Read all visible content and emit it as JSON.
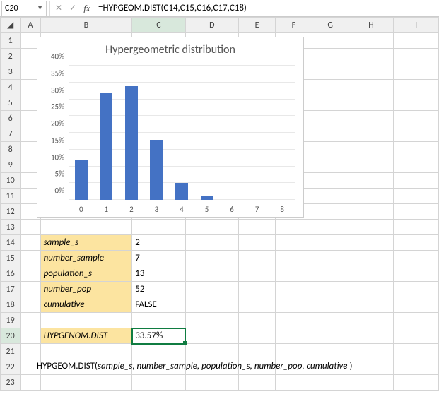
{
  "formula_bar": {
    "cell_ref": "C20",
    "formula": "=HYPGEOM.DIST(C14,C15,C16,C17,C18)",
    "cancel": "✕",
    "enter": "✓",
    "fx": "fx"
  },
  "columns": [
    "A",
    "B",
    "C",
    "D",
    "E",
    "F",
    "G",
    "H",
    "I"
  ],
  "rows": [
    "1",
    "2",
    "3",
    "4",
    "5",
    "6",
    "7",
    "8",
    "9",
    "10",
    "11",
    "12",
    "13",
    "14",
    "15",
    "16",
    "17",
    "18",
    "19",
    "20",
    "21",
    "22",
    "23"
  ],
  "params": {
    "r14": {
      "label": "sample_s",
      "value": "2"
    },
    "r15": {
      "label": "number_sample",
      "value": "7"
    },
    "r16": {
      "label": "population_s",
      "value": "13"
    },
    "r17": {
      "label": "number_pop",
      "value": "52"
    },
    "r18": {
      "label": "cumulative",
      "value": "FALSE"
    }
  },
  "result": {
    "label": "HYPGENOM.DIST",
    "value": "33.57%"
  },
  "syntax": {
    "fn": "HYPGEOM.DIST(",
    "args": "sample_s, number_sample, population_s, number_pop, cumulative",
    "end": " )"
  },
  "chart_data": {
    "type": "bar",
    "title": "Hypergeometric distribution",
    "categories": [
      "0",
      "1",
      "2",
      "3",
      "4",
      "5",
      "6",
      "7",
      "8"
    ],
    "values": [
      12,
      32,
      34,
      18,
      5,
      1,
      0,
      0,
      0
    ],
    "ylim": [
      0,
      40
    ],
    "yticks": [
      "0%",
      "5%",
      "10%",
      "15%",
      "20%",
      "25%",
      "30%",
      "35%",
      "40%"
    ],
    "xlabel": "",
    "ylabel": ""
  }
}
